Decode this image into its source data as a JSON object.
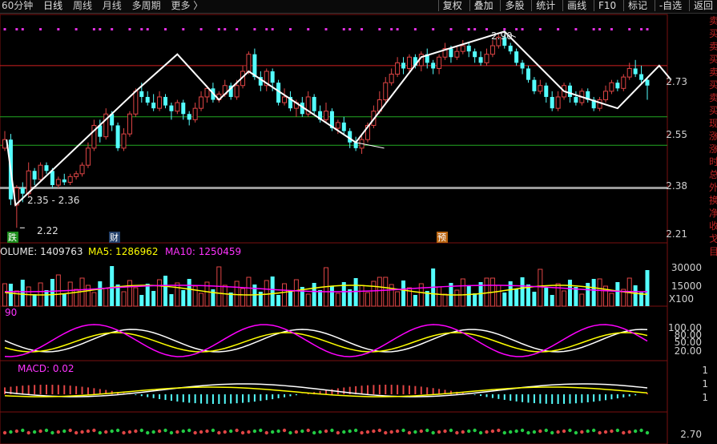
{
  "toolbar": {
    "left": [
      "60分钟",
      "日线",
      "周线",
      "月线",
      "多周期",
      "更多 〉"
    ],
    "active": "日线",
    "right": [
      "复权",
      "叠加",
      "多股",
      "统计",
      "画线",
      "F10",
      "标记",
      "-自选",
      "返回"
    ]
  },
  "price_axis": {
    "ticks": [
      "2.73",
      "2.55",
      "2.38",
      "2.21"
    ]
  },
  "annotations": {
    "high": "2.90",
    "low": "2.22",
    "low_range": "2.35 - 2.36",
    "mark_drop": "跌",
    "mark_fin": "财",
    "mark_pre": "预"
  },
  "volume": {
    "label": "OLUME: 1409763",
    "ma5": "MA5: 1286962",
    "ma10": "MA10: 1250459",
    "ticks": [
      "30000",
      "15000",
      "X100"
    ]
  },
  "kdj": {
    "label": "90",
    "ticks": [
      "100.00",
      "80.00",
      "50.00",
      "20.00"
    ]
  },
  "macd": {
    "label": "MACD: 0.02",
    "ticks": [
      "1",
      "1",
      "1"
    ]
  },
  "bottom": {
    "ticks": [
      "2.70"
    ]
  },
  "side_text": [
    "卖",
    "买",
    "卖",
    "买",
    "卖",
    "买",
    "卖",
    "买",
    "现",
    "涨",
    "涨",
    "时",
    "总",
    "外",
    "换",
    "净",
    "收",
    "戈",
    "目"
  ],
  "colors": {
    "up": "#e04545",
    "down": "#54ffff",
    "ma5": "#ffffff",
    "ma10": "#ffff00",
    "ma20": "#ff00ff",
    "trend": "#ffffff"
  },
  "chart_data": {
    "type": "candlestick",
    "ylim": [
      2.17,
      2.97
    ],
    "candles": [
      [
        2.5,
        2.53,
        2.56,
        2.49
      ],
      [
        2.53,
        2.32,
        2.55,
        2.3
      ],
      [
        2.3,
        2.36,
        2.37,
        2.22
      ],
      [
        2.36,
        2.34,
        2.38,
        2.31
      ],
      [
        2.34,
        2.42,
        2.45,
        2.33
      ],
      [
        2.42,
        2.39,
        2.43,
        2.37
      ],
      [
        2.39,
        2.44,
        2.45,
        2.38
      ],
      [
        2.44,
        2.42,
        2.45,
        2.41
      ],
      [
        2.42,
        2.37,
        2.43,
        2.36
      ],
      [
        2.37,
        2.39,
        2.4,
        2.36
      ],
      [
        2.39,
        2.38,
        2.41,
        2.37
      ],
      [
        2.38,
        2.4,
        2.41,
        2.37
      ],
      [
        2.4,
        2.41,
        2.42,
        2.39
      ],
      [
        2.41,
        2.44,
        2.45,
        2.4
      ],
      [
        2.44,
        2.5,
        2.52,
        2.43
      ],
      [
        2.5,
        2.58,
        2.6,
        2.49
      ],
      [
        2.58,
        2.54,
        2.6,
        2.52
      ],
      [
        2.54,
        2.62,
        2.64,
        2.53
      ],
      [
        2.62,
        2.58,
        2.63,
        2.56
      ],
      [
        2.58,
        2.5,
        2.59,
        2.49
      ],
      [
        2.5,
        2.55,
        2.57,
        2.49
      ],
      [
        2.55,
        2.62,
        2.63,
        2.54
      ],
      [
        2.62,
        2.7,
        2.71,
        2.61
      ],
      [
        2.7,
        2.68,
        2.73,
        2.66
      ],
      [
        2.68,
        2.66,
        2.7,
        2.65
      ],
      [
        2.66,
        2.64,
        2.69,
        2.63
      ],
      [
        2.64,
        2.68,
        2.7,
        2.63
      ],
      [
        2.68,
        2.65,
        2.69,
        2.64
      ],
      [
        2.65,
        2.63,
        2.66,
        2.6
      ],
      [
        2.63,
        2.66,
        2.67,
        2.62
      ],
      [
        2.66,
        2.62,
        2.67,
        2.6
      ],
      [
        2.62,
        2.6,
        2.63,
        2.58
      ],
      [
        2.6,
        2.64,
        2.66,
        2.59
      ],
      [
        2.64,
        2.68,
        2.7,
        2.63
      ],
      [
        2.68,
        2.71,
        2.72,
        2.66
      ],
      [
        2.71,
        2.67,
        2.73,
        2.66
      ],
      [
        2.67,
        2.69,
        2.7,
        2.66
      ],
      [
        2.69,
        2.72,
        2.74,
        2.68
      ],
      [
        2.72,
        2.68,
        2.73,
        2.67
      ],
      [
        2.68,
        2.72,
        2.74,
        2.67
      ],
      [
        2.72,
        2.77,
        2.79,
        2.71
      ],
      [
        2.77,
        2.83,
        2.84,
        2.76
      ],
      [
        2.83,
        2.75,
        2.85,
        2.74
      ],
      [
        2.75,
        2.72,
        2.77,
        2.7
      ],
      [
        2.72,
        2.77,
        2.78,
        2.7
      ],
      [
        2.77,
        2.73,
        2.78,
        2.7
      ],
      [
        2.73,
        2.66,
        2.74,
        2.65
      ],
      [
        2.66,
        2.68,
        2.71,
        2.65
      ],
      [
        2.68,
        2.64,
        2.7,
        2.63
      ],
      [
        2.64,
        2.66,
        2.67,
        2.61
      ],
      [
        2.66,
        2.62,
        2.68,
        2.61
      ],
      [
        2.62,
        2.68,
        2.7,
        2.61
      ],
      [
        2.68,
        2.63,
        2.69,
        2.62
      ],
      [
        2.63,
        2.6,
        2.65,
        2.59
      ],
      [
        2.6,
        2.63,
        2.66,
        2.59
      ],
      [
        2.63,
        2.57,
        2.64,
        2.56
      ],
      [
        2.57,
        2.59,
        2.6,
        2.55
      ],
      [
        2.59,
        2.56,
        2.61,
        2.55
      ],
      [
        2.56,
        2.52,
        2.57,
        2.5
      ],
      [
        2.52,
        2.5,
        2.54,
        2.49
      ],
      [
        2.5,
        2.53,
        2.55,
        2.48
      ],
      [
        2.53,
        2.58,
        2.59,
        2.52
      ],
      [
        2.58,
        2.63,
        2.65,
        2.57
      ],
      [
        2.63,
        2.67,
        2.7,
        2.62
      ],
      [
        2.67,
        2.73,
        2.75,
        2.66
      ],
      [
        2.73,
        2.76,
        2.78,
        2.72
      ],
      [
        2.76,
        2.8,
        2.82,
        2.75
      ],
      [
        2.8,
        2.78,
        2.82,
        2.76
      ],
      [
        2.78,
        2.82,
        2.83,
        2.77
      ],
      [
        2.82,
        2.79,
        2.83,
        2.78
      ],
      [
        2.79,
        2.83,
        2.84,
        2.77
      ],
      [
        2.83,
        2.8,
        2.85,
        2.78
      ],
      [
        2.8,
        2.78,
        2.81,
        2.76
      ],
      [
        2.78,
        2.82,
        2.83,
        2.76
      ],
      [
        2.82,
        2.85,
        2.87,
        2.81
      ],
      [
        2.85,
        2.82,
        2.86,
        2.8
      ],
      [
        2.82,
        2.84,
        2.86,
        2.81
      ],
      [
        2.84,
        2.86,
        2.88,
        2.83
      ],
      [
        2.86,
        2.84,
        2.87,
        2.82
      ],
      [
        2.84,
        2.82,
        2.85,
        2.8
      ],
      [
        2.82,
        2.8,
        2.84,
        2.79
      ],
      [
        2.8,
        2.83,
        2.85,
        2.79
      ],
      [
        2.83,
        2.86,
        2.88,
        2.82
      ],
      [
        2.86,
        2.89,
        2.9,
        2.85
      ],
      [
        2.89,
        2.86,
        2.9,
        2.85
      ],
      [
        2.86,
        2.84,
        2.87,
        2.83
      ],
      [
        2.84,
        2.8,
        2.85,
        2.79
      ],
      [
        2.8,
        2.78,
        2.81,
        2.76
      ],
      [
        2.78,
        2.74,
        2.79,
        2.73
      ],
      [
        2.74,
        2.7,
        2.75,
        2.69
      ],
      [
        2.7,
        2.72,
        2.74,
        2.69
      ],
      [
        2.72,
        2.68,
        2.73,
        2.66
      ],
      [
        2.68,
        2.64,
        2.7,
        2.63
      ],
      [
        2.64,
        2.68,
        2.7,
        2.63
      ],
      [
        2.68,
        2.72,
        2.73,
        2.67
      ],
      [
        2.72,
        2.68,
        2.73,
        2.66
      ],
      [
        2.68,
        2.66,
        2.7,
        2.65
      ],
      [
        2.66,
        2.7,
        2.71,
        2.65
      ],
      [
        2.7,
        2.67,
        2.71,
        2.66
      ],
      [
        2.67,
        2.64,
        2.68,
        2.63
      ],
      [
        2.64,
        2.67,
        2.68,
        2.63
      ],
      [
        2.67,
        2.7,
        2.72,
        2.66
      ],
      [
        2.7,
        2.73,
        2.74,
        2.69
      ],
      [
        2.73,
        2.71,
        2.74,
        2.7
      ],
      [
        2.71,
        2.75,
        2.76,
        2.7
      ],
      [
        2.75,
        2.78,
        2.8,
        2.74
      ],
      [
        2.78,
        2.76,
        2.81,
        2.75
      ],
      [
        2.76,
        2.74,
        2.79,
        2.73
      ],
      [
        2.74,
        2.72,
        2.75,
        2.67
      ]
    ],
    "trend_points": [
      [
        0.3,
        2.53
      ],
      [
        1.8,
        2.3
      ],
      [
        22,
        2.7
      ],
      [
        29,
        2.83
      ],
      [
        36,
        2.67
      ],
      [
        41,
        2.77
      ],
      [
        59,
        2.52
      ],
      [
        70,
        2.82
      ],
      [
        84,
        2.91
      ],
      [
        94,
        2.7
      ],
      [
        103,
        2.64
      ],
      [
        110,
        2.79
      ],
      [
        112,
        2.74
      ]
    ],
    "h_lines": [
      {
        "y": 2.79,
        "color": "#d02020"
      },
      {
        "y": 2.61,
        "color": "#22aa22"
      },
      {
        "y": 2.51,
        "color": "#22aa22"
      },
      {
        "y": 2.36,
        "color": "#9a9a9a"
      }
    ]
  }
}
